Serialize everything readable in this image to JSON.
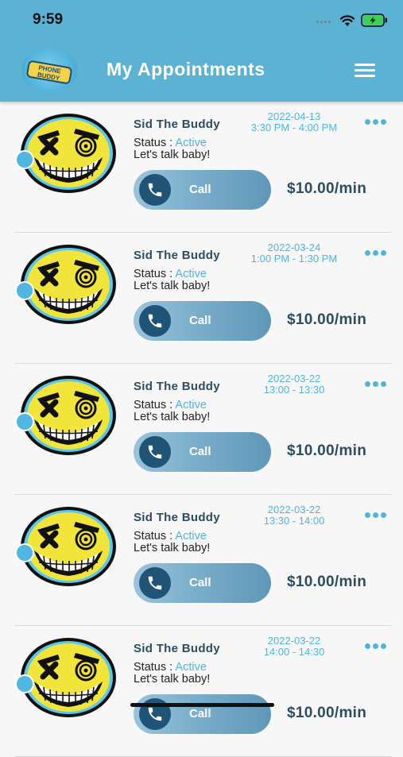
{
  "status_bar": {
    "time": "9:59"
  },
  "header": {
    "logo_text": "PHONE BUDDY",
    "title": "My Appointments"
  },
  "status_label": "Status : ",
  "call_label": "Call",
  "appointments": [
    {
      "name": "Sid The Buddy",
      "date": "2022-04-13",
      "time": "3:30 PM - 4:00 PM",
      "status": "Active",
      "message": "Let's talk baby!",
      "price": "$10.00/min"
    },
    {
      "name": "Sid The Buddy",
      "date": "2022-03-24",
      "time": "1:00 PM - 1:30 PM",
      "status": "Active",
      "message": "Let's talk baby!",
      "price": "$10.00/min"
    },
    {
      "name": "Sid The Buddy",
      "date": "2022-03-22",
      "time": "13:00 - 13:30",
      "status": "Active",
      "message": "Let's talk baby!",
      "price": "$10.00/min"
    },
    {
      "name": "Sid The Buddy",
      "date": "2022-03-22",
      "time": "13:30 - 14:00",
      "status": "Active",
      "message": "Let's talk baby!",
      "price": "$10.00/min"
    },
    {
      "name": "Sid The Buddy",
      "date": "2022-03-22",
      "time": "14:00 - 14:30",
      "status": "Active",
      "message": "Let's talk baby!",
      "price": "$10.00/min"
    }
  ],
  "colors": {
    "header": "#5bb2d3",
    "accent": "#4fb4dc",
    "dark_text": "#2d4d5e",
    "call_icon": "#1f5476"
  },
  "icons": [
    "signal-icon",
    "wifi-icon",
    "battery-icon",
    "menu-icon",
    "more-icon",
    "phone-icon",
    "avatar-smiley-icon"
  ]
}
